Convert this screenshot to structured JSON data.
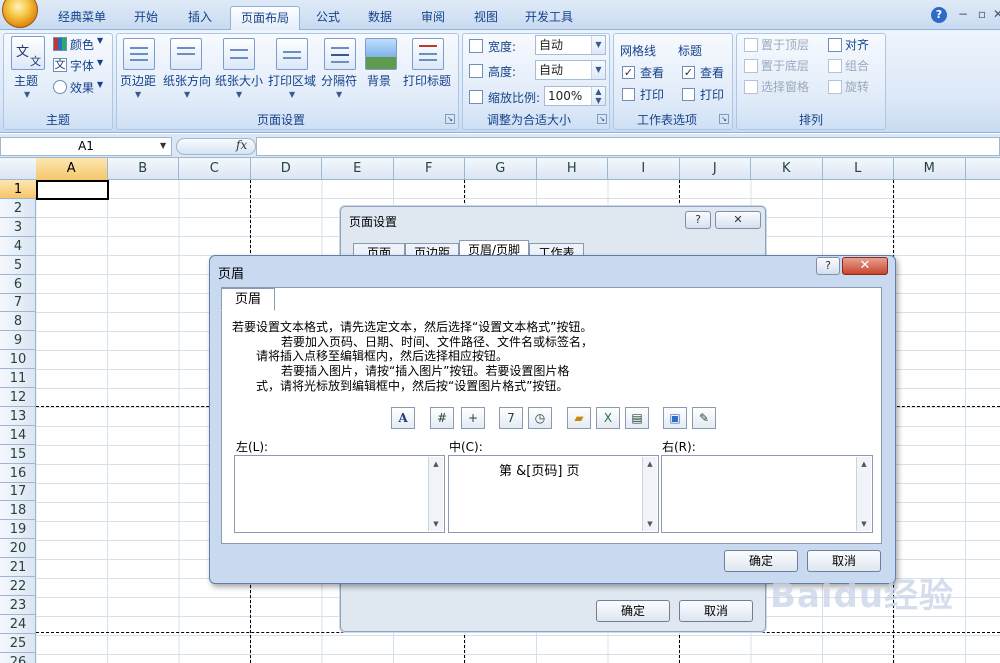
{
  "ribbon_tabs": [
    "经典菜单",
    "开始",
    "插入",
    "页面布局",
    "公式",
    "数据",
    "审阅",
    "视图",
    "开发工具"
  ],
  "active_tab": "页面布局",
  "ribbon": {
    "theme_group": {
      "big_label": "主题",
      "colors": "颜色",
      "fonts": "字体",
      "effects": "效果",
      "group_label": "主题"
    },
    "page_setup_group": {
      "margins": "页边距",
      "orientation": "纸张方向",
      "size": "纸张大小",
      "print_area": "打印区域",
      "breaks": "分隔符",
      "background": "背景",
      "print_titles": "打印标题",
      "group_label": "页面设置"
    },
    "scale_group": {
      "width_label": "宽度:",
      "width_value": "自动",
      "height_label": "高度:",
      "height_value": "自动",
      "scale_label": "缩放比例:",
      "scale_value": "100%",
      "group_label": "调整为合适大小"
    },
    "sheet_options_group": {
      "gridlines": "网格线",
      "headings": "标题",
      "view": "查看",
      "print": "打印",
      "group_label": "工作表选项"
    },
    "arrange_group": {
      "bring_front": "置于顶层",
      "send_back": "置于底层",
      "selection_pane": "选择窗格",
      "align": "对齐",
      "group": "组合",
      "rotate": "旋转",
      "group_label": "排列"
    }
  },
  "formula_bar": {
    "name_box": "A1",
    "fx": "fx",
    "formula": ""
  },
  "columns": [
    "A",
    "B",
    "C",
    "D",
    "E",
    "F",
    "G",
    "H",
    "I",
    "J",
    "K",
    "L",
    "M"
  ],
  "rows": [
    "1",
    "2",
    "3",
    "4",
    "5",
    "6",
    "7",
    "8",
    "9",
    "10",
    "11",
    "12",
    "13",
    "14",
    "15",
    "16",
    "17",
    "18",
    "19",
    "20",
    "21",
    "22",
    "23",
    "24",
    "25",
    "26"
  ],
  "page_setup_dialog": {
    "title": "页面设置",
    "help": "?",
    "close": "✕",
    "tabs": [
      "页面",
      "页边距",
      "页眉/页脚",
      "工作表"
    ],
    "ok": "确定",
    "cancel": "取消"
  },
  "header_dialog": {
    "title": "页眉",
    "help": "?",
    "close": "✕",
    "tab": "页眉",
    "instructions": [
      "若要设置文本格式，请先选定文本，然后选择“设置文本格式”按钮。",
      "若要加入页码、日期、时间、文件路径、文件名或标签名，",
      "请将插入点移至编辑框内，然后选择相应按钮。",
      "若要插入图片，请按“插入图片”按钮。若要设置图片格",
      "式，请将光标放到编辑框中，然后按“设置图片格式”按钮。"
    ],
    "left_label": "左(L):",
    "center_label": "中(C):",
    "right_label": "右(R):",
    "center_text": "第 &[页码] 页",
    "ok": "确定",
    "cancel": "取消"
  },
  "watermark": "Baidu经验"
}
